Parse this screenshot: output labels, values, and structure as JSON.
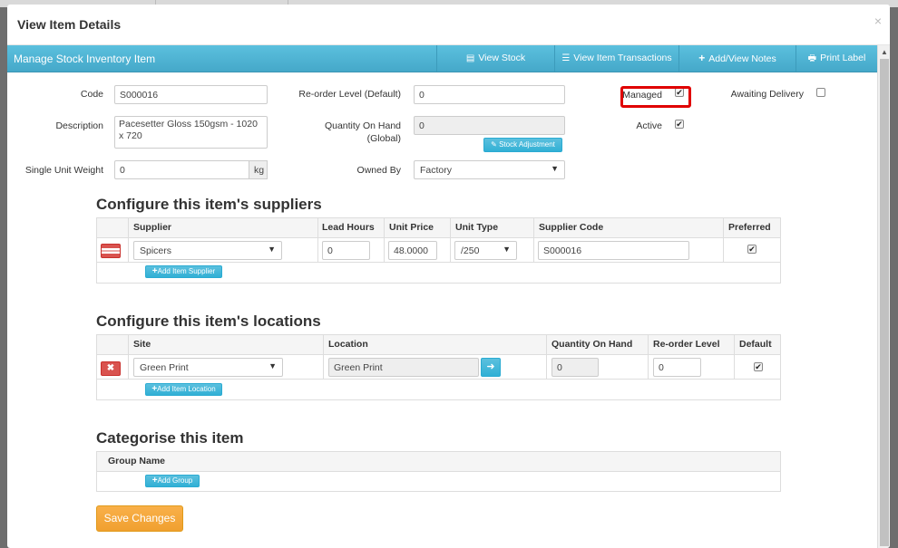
{
  "modal": {
    "title": "View Item Details",
    "close": "×"
  },
  "bar": {
    "title": "Manage Stock Inventory Item",
    "view_stock": "View Stock",
    "view_transactions": "View Item Transactions",
    "notes": "Add/View Notes",
    "print_label": "Print Label"
  },
  "form": {
    "code_label": "Code",
    "code_value": "S000016",
    "desc_label": "Description",
    "desc_value": "Pacesetter Gloss 150gsm - 1020 x 720",
    "weight_label": "Single Unit Weight",
    "weight_value": "0",
    "weight_unit": "kg",
    "reorder_label": "Re-order Level (Default)",
    "reorder_value": "0",
    "qoh_label_1": "Quantity On Hand",
    "qoh_label_2": "(Global)",
    "qoh_value": "0",
    "stock_adjust": "Stock Adjustment",
    "owned_label": "Owned By",
    "owned_value": "Factory",
    "managed_label": "Managed",
    "active_label": "Active",
    "awaiting_label": "Awaiting Delivery"
  },
  "suppliers": {
    "title": "Configure this item's suppliers",
    "headers": [
      "Supplier",
      "Lead Hours",
      "Unit Price",
      "Unit Type",
      "Supplier Code",
      "Preferred"
    ],
    "row": {
      "supplier": "Spicers",
      "lead_hours": "0",
      "unit_price": "48.0000",
      "unit_type": "/250",
      "supplier_code": "S000016"
    },
    "add_label": "Add Item Supplier"
  },
  "locations": {
    "title": "Configure this item's locations",
    "headers": [
      "Site",
      "Location",
      "Quantity On Hand",
      "Re-order Level",
      "Default"
    ],
    "row": {
      "site": "Green Print",
      "location": "Green Print",
      "qoh": "0",
      "reorder": "0"
    },
    "add_label": "Add Item Location"
  },
  "categories": {
    "title": "Categorise this item",
    "header": "Group Name",
    "add_label": "Add Group"
  },
  "save_label": "Save Changes",
  "colors": {
    "accent": "#5bc0de",
    "danger": "#d9534f",
    "warning": "#f0ad4e",
    "highlight": "#e00000"
  }
}
